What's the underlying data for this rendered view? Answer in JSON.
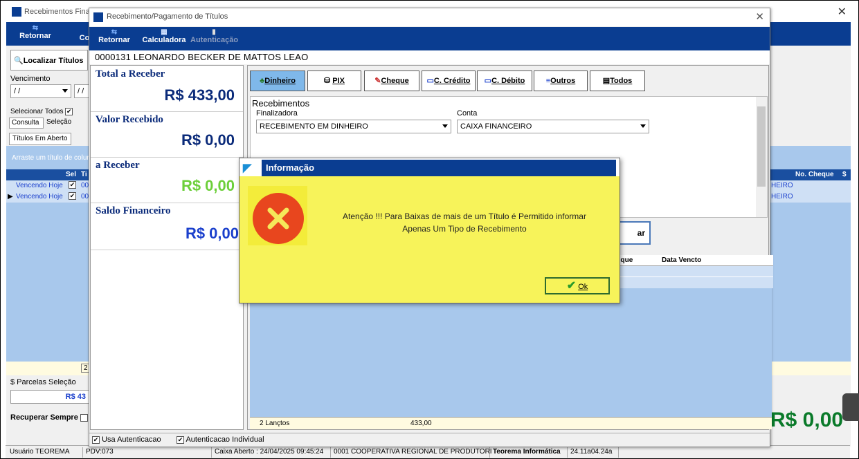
{
  "background": {
    "title": "Recebimentos Finar",
    "toolbar": [
      "Retornar",
      "Co"
    ],
    "localizar": "Localizar Títulos",
    "vencimento_label": "Vencimento",
    "date1": "/ /",
    "date2": "/ /",
    "selecionar_todos": "Selecionar Todos",
    "tabs": [
      "Consulta",
      "Seleção"
    ],
    "titulos_tab": "Títulos Em Aberto",
    "group_hint": "Arraste um título de colun",
    "grid_headers": [
      "Sel",
      "Ti"
    ],
    "rows": [
      {
        "status": "Vencendo Hoje",
        "code": "00",
        "right": "HEIRO"
      },
      {
        "status": "Vencendo Hoje",
        "code": "00",
        "right": "HEIRO"
      }
    ],
    "right_headers": [
      "No. Cheque",
      "$"
    ],
    "count_cell": "2",
    "parcelas_label": "$ Parcelas Seleção",
    "parcelas_value": "R$ 43",
    "recuperar": "Recuperar Sempre",
    "big_value": "R$ 0,00"
  },
  "statusbar": {
    "usuario": "Usuário TEOREMA",
    "pdv": "PDV:073",
    "caixa": "Caixa Aberto : 24/04/2025 09:45:24",
    "coop": "0001 COOPERATIVA REGIONAL DE PRODUTORI",
    "teorema": "Teorema Informática",
    "versao": "24.11a04.24a"
  },
  "dialog": {
    "title": "Recebimento/Pagamento de Títulos",
    "toolbar": {
      "retornar": "Retornar",
      "calculadora": "Calculadora",
      "autenticacao": "Autenticação"
    },
    "client": "0000131 LEONARDO BECKER DE MATTOS LEAO",
    "totals": [
      {
        "label": "Total a Receber",
        "value": "R$ 433,00",
        "color": "#0b2b7a"
      },
      {
        "label": "Valor Recebido",
        "value": "R$ 0,00",
        "color": "#0b2b7a"
      },
      {
        "label": "a Receber",
        "value": "R$ 0,00",
        "color": "#6ccf3a"
      },
      {
        "label": "Saldo Financeiro",
        "value": "R$ 0,00",
        "color": "#1a3fcc"
      }
    ],
    "tabs": [
      "Dinheiro",
      "PIX",
      "Cheque",
      "C. Crédito",
      "C. Débito",
      "Outros",
      "Todos"
    ],
    "recebimentos_title": "Recebimentos",
    "finalizadora_label": "Finalizadora",
    "finalizadora_value": "RECEBIMENTO EM DINHEIRO",
    "conta_label": "Conta",
    "conta_value": "CAIXA FINANCEIRO",
    "action_button": "ar",
    "grid_headers": [
      "eque",
      "Data Vencto"
    ],
    "footer_count": "2 Lançtos",
    "footer_total": "433,00",
    "usa_autenticacao": "Usa Autenticacao",
    "autenticacao_individual": "Autenticacao Individual"
  },
  "info": {
    "title": "Informação",
    "message_line1": "Atenção !!! Para Baixas de mais de um Título é Permitido informar",
    "message_line2": "Apenas Um Tipo de Recebimento",
    "ok": "Ok"
  }
}
